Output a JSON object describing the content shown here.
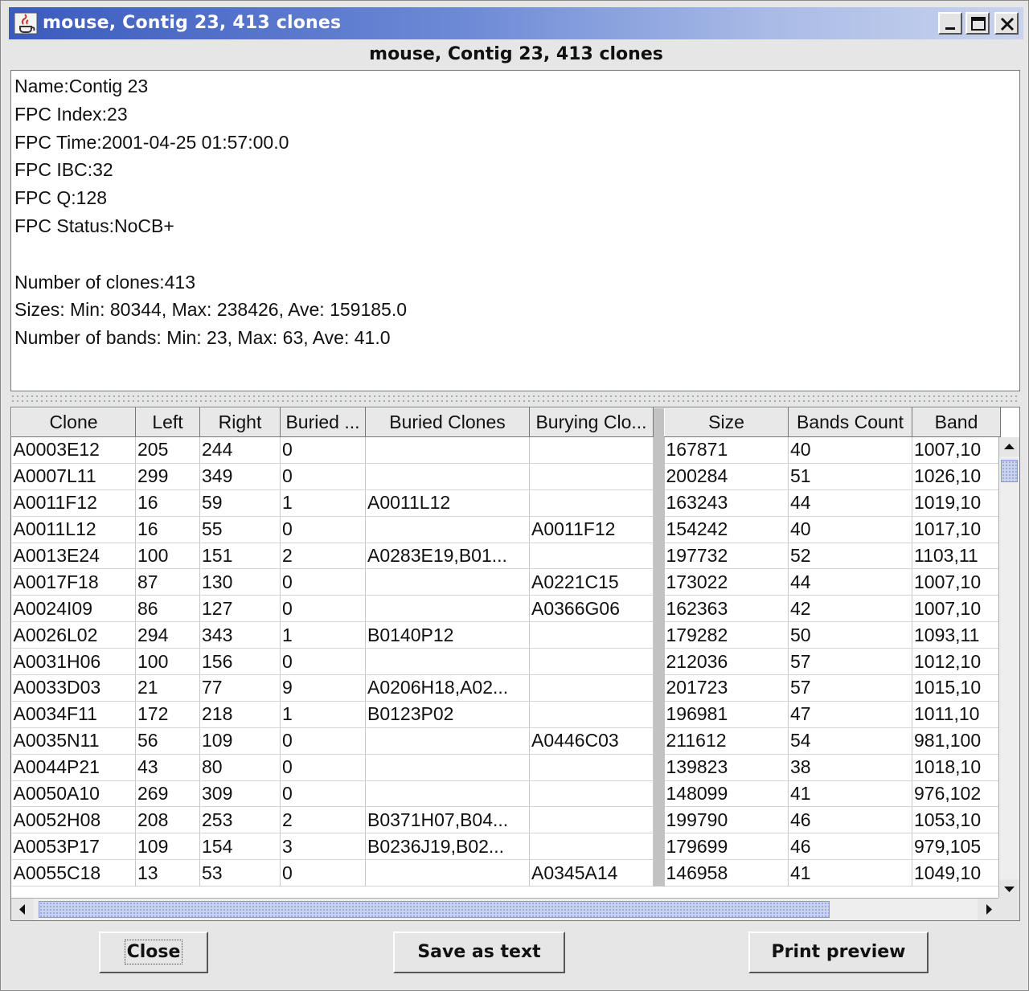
{
  "window": {
    "title": "mouse, Contig 23, 413 clones",
    "heading": "mouse, Contig 23, 413 clones"
  },
  "info": {
    "lines": [
      "Name:Contig 23",
      "FPC Index:23",
      "FPC Time:2001-04-25 01:57:00.0",
      "FPC IBC:32",
      "FPC Q:128",
      "FPC Status:NoCB+",
      "",
      "Number of clones:413",
      "Sizes: Min: 80344, Max: 238426, Ave: 159185.0",
      "Number of bands: Min: 23, Max: 63, Ave: 41.0"
    ]
  },
  "table": {
    "headers": [
      "Clone",
      "Left",
      "Right",
      "Buried ...",
      "Buried Clones",
      "Burying Clo...",
      "Size",
      "Bands Count",
      "Band"
    ],
    "rows": [
      [
        "A0003E12",
        "205",
        "244",
        "0",
        "",
        "",
        "167871",
        "40",
        "1007,10"
      ],
      [
        "A0007L11",
        "299",
        "349",
        "0",
        "",
        "",
        "200284",
        "51",
        "1026,10"
      ],
      [
        "A0011F12",
        "16",
        "59",
        "1",
        "A0011L12",
        "",
        "163243",
        "44",
        "1019,10"
      ],
      [
        "A0011L12",
        "16",
        "55",
        "0",
        "",
        "A0011F12",
        "154242",
        "40",
        "1017,10"
      ],
      [
        "A0013E24",
        "100",
        "151",
        "2",
        "A0283E19,B01...",
        "",
        "197732",
        "52",
        "1103,11"
      ],
      [
        "A0017F18",
        "87",
        "130",
        "0",
        "",
        "A0221C15",
        "173022",
        "44",
        "1007,10"
      ],
      [
        "A0024I09",
        "86",
        "127",
        "0",
        "",
        "A0366G06",
        "162363",
        "42",
        "1007,10"
      ],
      [
        "A0026L02",
        "294",
        "343",
        "1",
        "B0140P12",
        "",
        "179282",
        "50",
        "1093,11"
      ],
      [
        "A0031H06",
        "100",
        "156",
        "0",
        "",
        "",
        "212036",
        "57",
        "1012,10"
      ],
      [
        "A0033D03",
        "21",
        "77",
        "9",
        "A0206H18,A02...",
        "",
        "201723",
        "57",
        "1015,10"
      ],
      [
        "A0034F11",
        "172",
        "218",
        "1",
        "B0123P02",
        "",
        "196981",
        "47",
        "1011,10"
      ],
      [
        "A0035N11",
        "56",
        "109",
        "0",
        "",
        "A0446C03",
        "211612",
        "54",
        "981,100"
      ],
      [
        "A0044P21",
        "43",
        "80",
        "0",
        "",
        "",
        "139823",
        "38",
        "1018,10"
      ],
      [
        "A0050A10",
        "269",
        "309",
        "0",
        "",
        "",
        "148099",
        "41",
        "976,102"
      ],
      [
        "A0052H08",
        "208",
        "253",
        "2",
        "B0371H07,B04...",
        "",
        "199790",
        "46",
        "1053,10"
      ],
      [
        "A0053P17",
        "109",
        "154",
        "3",
        "B0236J19,B02...",
        "",
        "179699",
        "46",
        "979,105"
      ],
      [
        "A0055C18",
        "13",
        "53",
        "0",
        "",
        "A0345A14",
        "146958",
        "41",
        "1049,10"
      ]
    ]
  },
  "buttons": {
    "close": "Close",
    "save": "Save as text",
    "print": "Print preview"
  },
  "colors": {
    "titlebar_start": "#3a5bbd",
    "titlebar_end": "#c9d3ee",
    "window_bg": "#e6e6e6",
    "scroll_thumb": "#c9d3f0"
  }
}
